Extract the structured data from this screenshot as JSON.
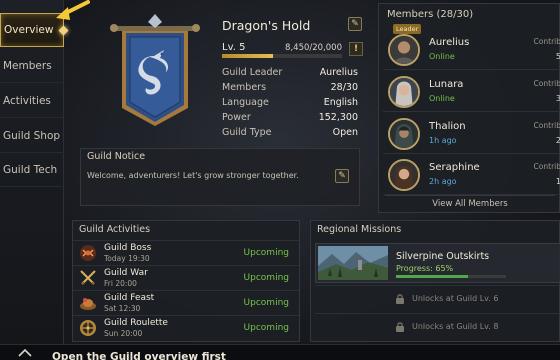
{
  "sidebar": {
    "items": [
      {
        "label": "Overview"
      },
      {
        "label": "Members"
      },
      {
        "label": "Activities"
      },
      {
        "label": "Guild Shop"
      },
      {
        "label": "Guild Tech"
      }
    ]
  },
  "guild": {
    "name": "Dragon's Hold",
    "level": "Lv. 5",
    "xp": "8,450/20,000",
    "xp_fraction": 0.4225,
    "stats": [
      {
        "key": "Guild Leader",
        "value": "Aurelius"
      },
      {
        "key": "Members",
        "value": "28/30"
      },
      {
        "key": "Language",
        "value": "English"
      },
      {
        "key": "Power",
        "value": "152,300"
      },
      {
        "key": "Guild Type",
        "value": "Open"
      }
    ]
  },
  "notice": {
    "title": "Guild Notice",
    "body": "Welcome, adventurers! Let's grow stronger together."
  },
  "members": {
    "title": "Members (28/30)",
    "leader_tag": "Leader",
    "contrib_label": "Contrib",
    "list": [
      {
        "name": "Aurelius",
        "status": "Online",
        "status_color": "#6fc14a",
        "contrib": "5",
        "leader": true
      },
      {
        "name": "Lunara",
        "status": "Online",
        "status_color": "#6fc14a",
        "contrib": "3",
        "leader": false
      },
      {
        "name": "Thalion",
        "status": "1h ago",
        "status_color": "#5aa9d8",
        "contrib": "2",
        "leader": false
      },
      {
        "name": "Seraphine",
        "status": "2h ago",
        "status_color": "#5aa9d8",
        "contrib": "1",
        "leader": false
      }
    ],
    "view_all": "View All Members"
  },
  "activities": {
    "title": "Guild Activities",
    "list": [
      {
        "name": "Guild Boss",
        "time": "Today 19:30",
        "status": "Upcoming",
        "icon": "boss-icon"
      },
      {
        "name": "Guild War",
        "time": "Fri 20:00",
        "status": "Upcoming",
        "icon": "crossed-swords-icon"
      },
      {
        "name": "Guild Feast",
        "time": "Sat 12:30",
        "status": "Upcoming",
        "icon": "feast-icon"
      },
      {
        "name": "Guild Roulette",
        "time": "Sun 20:00",
        "status": "Upcoming",
        "icon": "roulette-icon"
      }
    ]
  },
  "missions": {
    "title": "Regional Missions",
    "active": {
      "name": "Silverpine Outskirts",
      "progress": "Progress: 65%",
      "progress_fraction": 0.65
    },
    "locked": [
      {
        "text": "Unlocks at Guild Lv. 6"
      },
      {
        "text": "Unlocks at Guild Lv. 8"
      }
    ]
  },
  "bottom": {
    "text": "Open the Guild overview first"
  },
  "colors": {
    "accent_gold": "#c9a64a",
    "online": "#6fc14a",
    "upcoming": "#76c44b",
    "banner_blue": "#2d4f86"
  }
}
